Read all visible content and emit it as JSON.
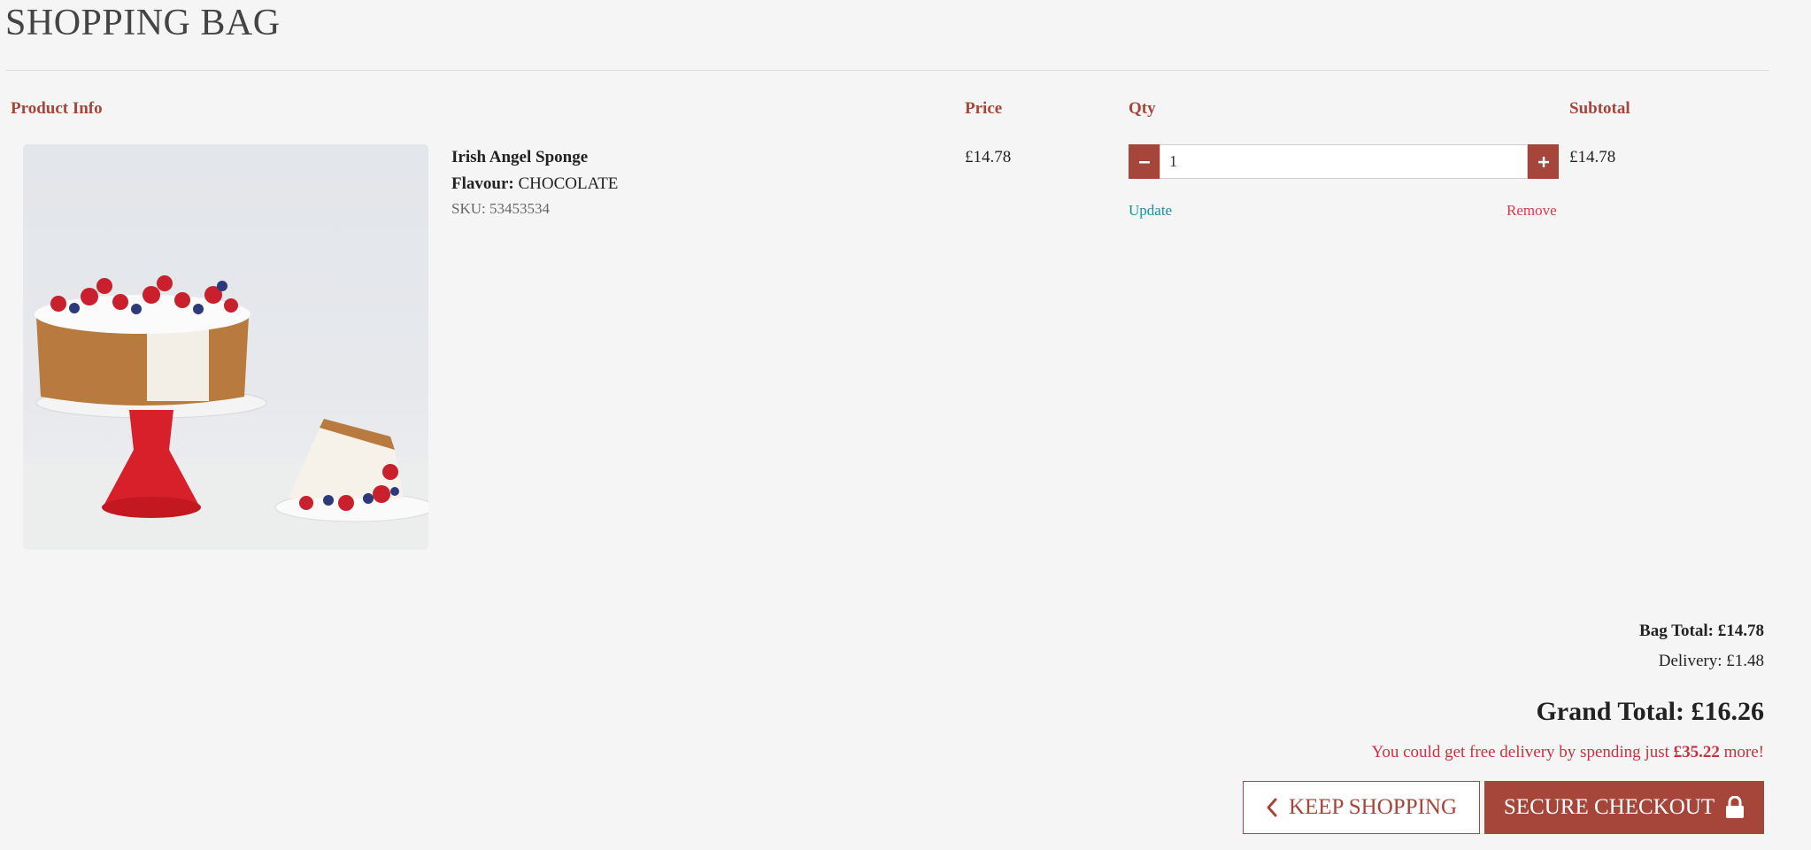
{
  "page": {
    "title": "SHOPPING BAG"
  },
  "columns": {
    "product_info": "Product Info",
    "price": "Price",
    "qty": "Qty",
    "subtotal": "Subtotal"
  },
  "item": {
    "name": "Irish Angel Sponge",
    "flavour_label": "Flavour:",
    "flavour_value": "CHOCOLATE",
    "sku": "SKU: 53453534",
    "price": "£14.78",
    "quantity": "1",
    "subtotal": "£14.78",
    "update_label": "Update",
    "remove_label": "Remove",
    "image_icon": "cake-on-stand-photo"
  },
  "totals": {
    "bag_total": "Bag Total: £14.78",
    "delivery": "Delivery: £1.48",
    "grand_total": "Grand Total: £16.26",
    "free_delivery_prefix": "You could get free delivery by spending just",
    "free_delivery_amount": "£35.22",
    "free_delivery_suffix": "more!"
  },
  "actions": {
    "keep_shopping": "KEEP SHOPPING",
    "secure_checkout": "SECURE CHECKOUT",
    "keep_icon": "chevron-left-icon",
    "checkout_icon": "lock-icon"
  },
  "colors": {
    "accent": "#a6463b",
    "link": "#1a8f9e",
    "alert": "#c8323f",
    "background": "#f5f5f5"
  }
}
